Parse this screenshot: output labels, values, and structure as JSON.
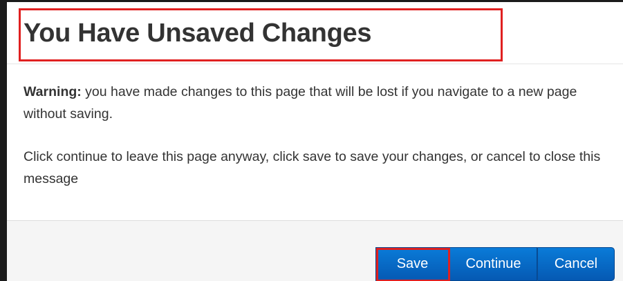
{
  "dialog": {
    "title": "You Have Unsaved Changes",
    "warning_label": "Warning:",
    "warning_text": " you have made changes to this page that will be lost if you navigate to a new page without saving.",
    "instructions": "Click continue to leave this page anyway, click save to save your changes, or cancel to close this message"
  },
  "footer": {
    "save_label": "Save",
    "continue_label": "Continue",
    "cancel_label": "Cancel"
  },
  "colors": {
    "button_primary": "#0a6fd0",
    "highlight": "#e02020",
    "text": "#333333",
    "footer_bg": "#f5f5f5"
  }
}
